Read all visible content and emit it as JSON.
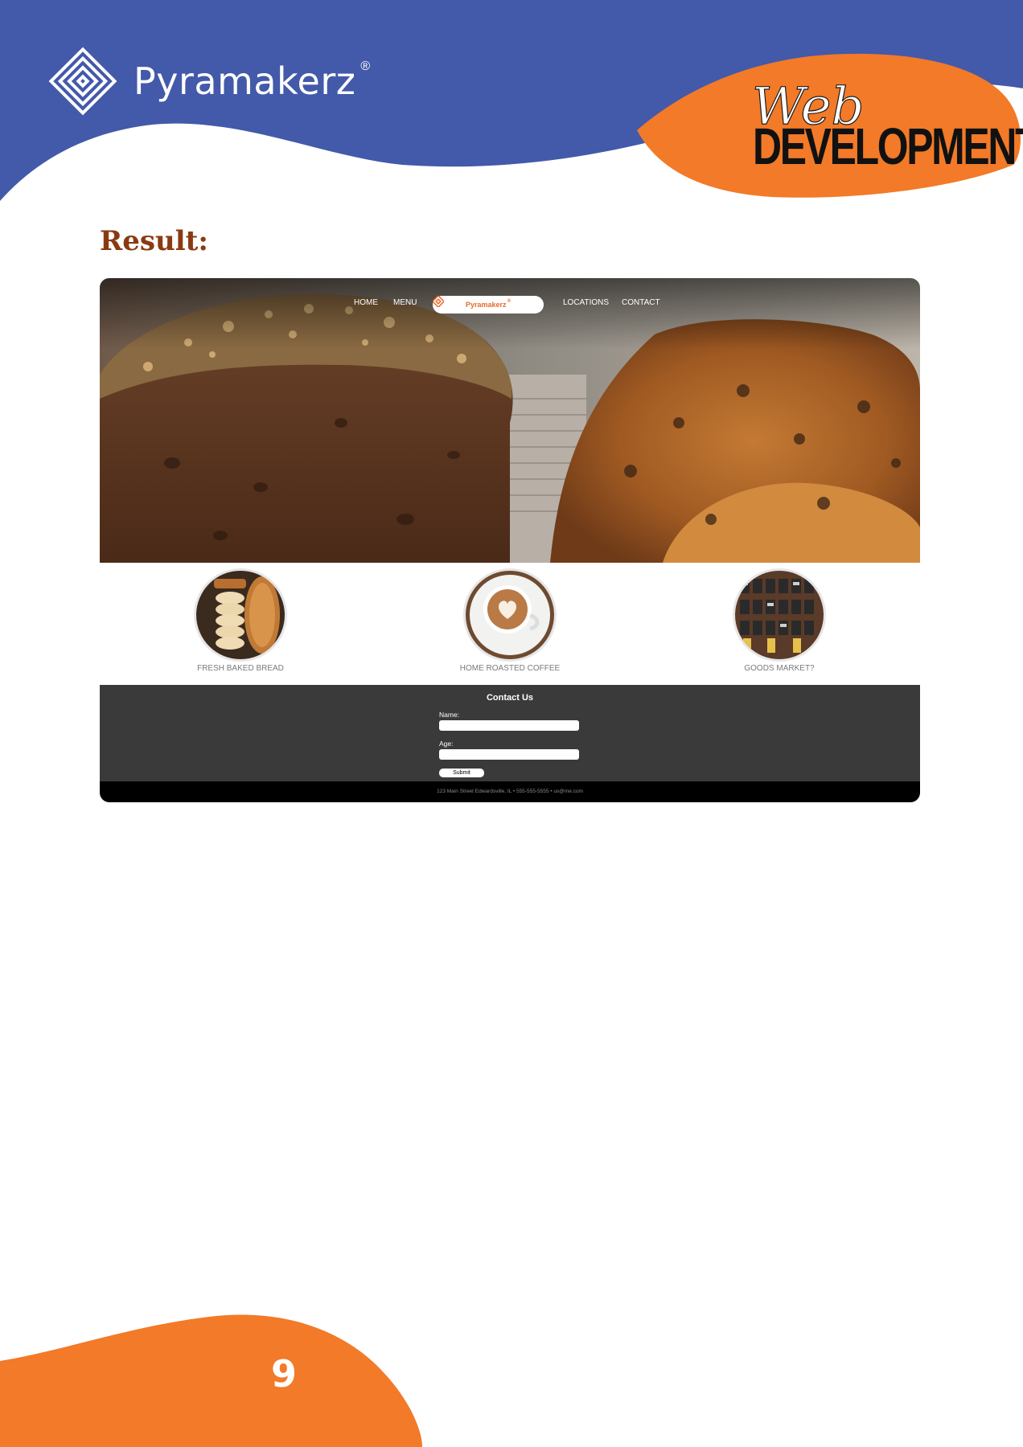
{
  "brand": {
    "name": "Pyramakerz",
    "registered": "®"
  },
  "course": {
    "script_word": "Web",
    "title_word": "DEVELOPMENT"
  },
  "section": {
    "heading": "Result:"
  },
  "preview": {
    "nav": {
      "links_left": [
        "HOME",
        "MENU"
      ],
      "logo_text": "Pyramakerz",
      "logo_mark": "®",
      "links_right": [
        "LOCATIONS",
        "CONTACT"
      ]
    },
    "features": [
      {
        "label": "FRESH BAKED BREAD",
        "image": "bread-photo"
      },
      {
        "label": "HOME ROASTED COFFEE",
        "image": "coffee-cup-photo"
      },
      {
        "label": "GOODS MARKET?",
        "image": "market-shelf-photo"
      }
    ],
    "contact": {
      "title": "Contact Us",
      "name_label": "Name:",
      "age_label": "Age:",
      "submit_label": "Submit"
    },
    "footer": {
      "text": "123 Main Street Edwardsville, IL • 555-555-5555 • us@me.com"
    }
  },
  "page": {
    "number": "9"
  },
  "colors": {
    "blue": "#4359aa",
    "orange": "#f27a28",
    "heading_brown": "#8a3a12",
    "contact_bg": "#3a3a3a"
  }
}
